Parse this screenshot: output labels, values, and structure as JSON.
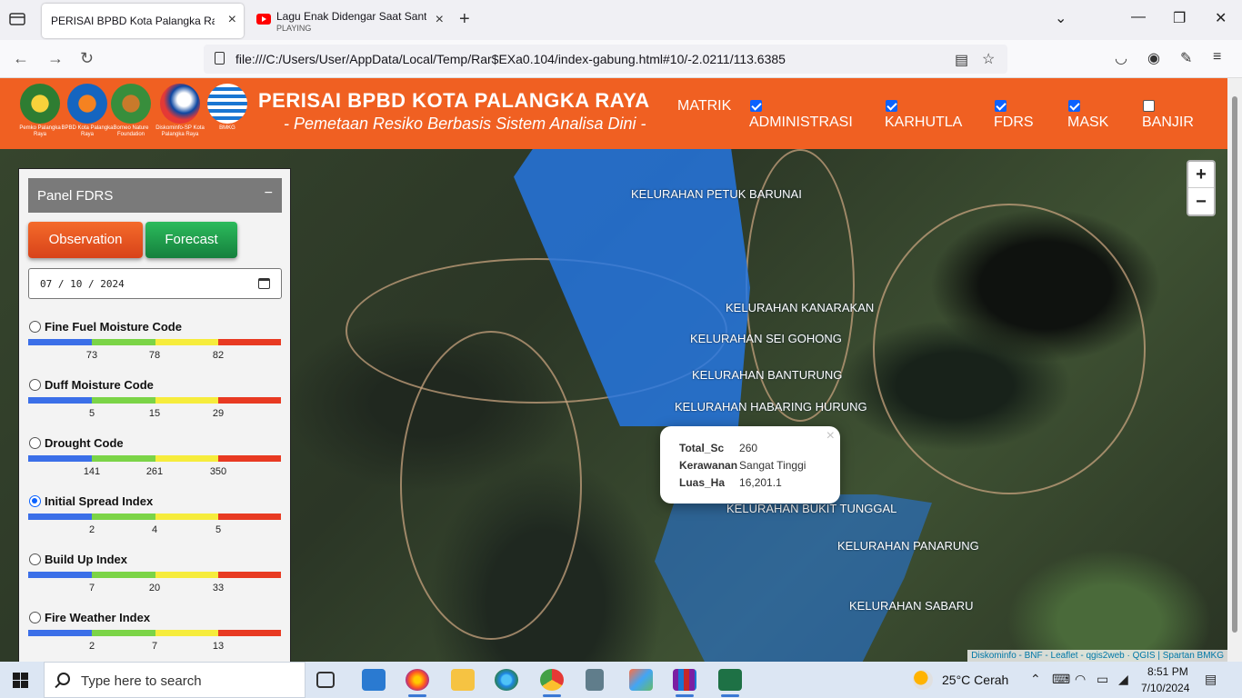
{
  "browser": {
    "tabs": [
      {
        "title": "PERISAI BPBD Kota Palangka Raya",
        "subtitle": ""
      },
      {
        "title": "Lagu Enak Didengar Saat Santai",
        "subtitle": "PLAYING"
      }
    ],
    "url": "file:///C:/Users/User/AppData/Local/Temp/Rar$EXa0.104/index-gabung.html#10/-2.0211/113.6385"
  },
  "header": {
    "title": "PERISAI BPBD KOTA PALANGKA RAYA",
    "subtitle": "- Pemetaan Resiko Berbasis Sistem Analisa Dini -",
    "logos": [
      {
        "caption": "Pemko Palangka Raya",
        "color": "#2e7d32"
      },
      {
        "caption": "BPBD Kota Palangka Raya",
        "color": "#1565c0"
      },
      {
        "caption": "Borneo Nature Foundation",
        "color": "#388e3c"
      },
      {
        "caption": "Diskominfo-SP Kota Palangka Raya",
        "color": "#0d47a1"
      },
      {
        "caption": "BMKG",
        "color": "#1976d2"
      }
    ],
    "menu_label": "MATRIK",
    "layers": [
      {
        "label": "ADMINISTRASI",
        "checked": true
      },
      {
        "label": "KARHUTLA",
        "checked": true
      },
      {
        "label": "FDRS",
        "checked": true
      },
      {
        "label": "MASK",
        "checked": true
      },
      {
        "label": "BANJIR",
        "checked": false
      }
    ]
  },
  "panel": {
    "title": "Panel FDRS",
    "collapse_glyph": "−",
    "observation_label": "Observation",
    "forecast_label": "Forecast",
    "date_value": "07 / 10 / 2024",
    "indices": [
      {
        "label": "Fine Fuel Moisture Code",
        "selected": false,
        "ticks": [
          "73",
          "78",
          "82"
        ]
      },
      {
        "label": "Duff Moisture Code",
        "selected": false,
        "ticks": [
          "5",
          "15",
          "29"
        ]
      },
      {
        "label": "Drought Code",
        "selected": false,
        "ticks": [
          "141",
          "261",
          "350"
        ]
      },
      {
        "label": "Initial Spread Index",
        "selected": true,
        "ticks": [
          "2",
          "4",
          "5"
        ]
      },
      {
        "label": "Build Up Index",
        "selected": false,
        "ticks": [
          "7",
          "20",
          "33"
        ]
      },
      {
        "label": "Fire Weather Index",
        "selected": false,
        "ticks": [
          "2",
          "7",
          "13"
        ]
      }
    ]
  },
  "map": {
    "kelurahan": [
      "KELURAHAN PETUK BARUNAI",
      "KELURAHAN KANARAKAN",
      "KELURAHAN SEI GOHONG",
      "KELURAHAN BANTURUNG",
      "KELURAHAN HABARING HURUNG",
      "KELURAHAN BUKIT TUNGGAL",
      "KELURAHAN PANARUNG",
      "KELURAHAN SABARU"
    ],
    "popup": {
      "rows": [
        {
          "key": "Total_Sc",
          "value": "260"
        },
        {
          "key": "Kerawanan",
          "value": "Sangat Tinggi"
        },
        {
          "key": "Luas_Ha",
          "value": "16,201.1"
        }
      ]
    },
    "zoom_in": "+",
    "zoom_out": "−",
    "attribution": "Diskominfo - BNF - Leaflet - qgis2web · QGIS | Spartan BMKG"
  },
  "taskbar": {
    "search_placeholder": "Type here to search",
    "weather": "25°C  Cerah",
    "time": "8:51 PM",
    "date": "7/10/2024"
  }
}
